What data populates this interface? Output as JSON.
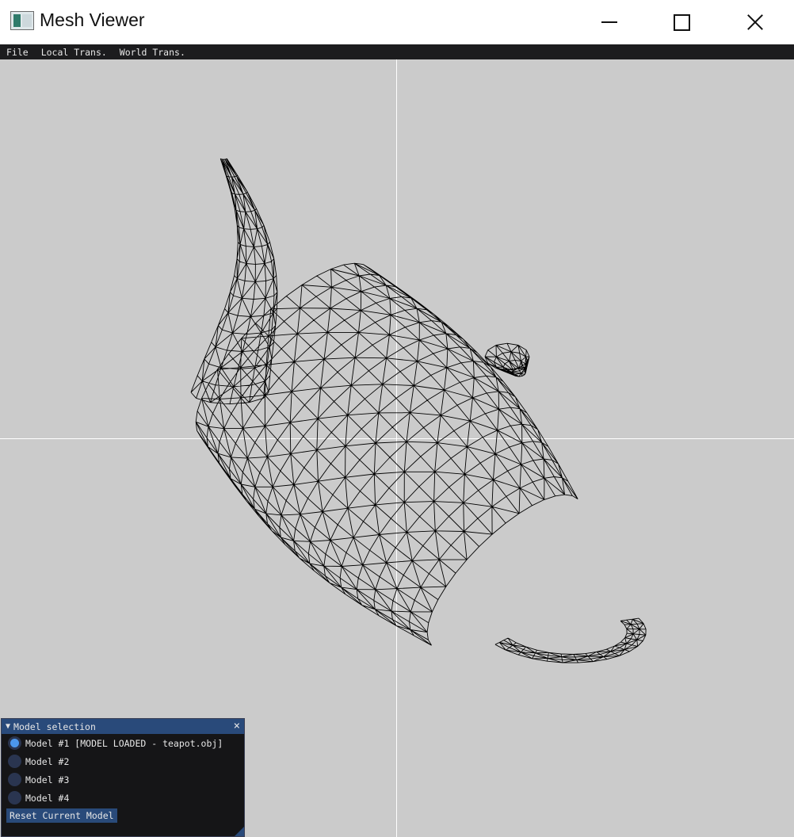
{
  "window": {
    "title": "Mesh Viewer",
    "icon": "app-window-icon",
    "controls": [
      "minimize-icon",
      "maximize-icon",
      "close-icon"
    ]
  },
  "menubar": {
    "items": [
      {
        "label": "File"
      },
      {
        "label": "Local Trans."
      },
      {
        "label": "World Trans."
      }
    ]
  },
  "viewport": {
    "background": "#cbcbcb",
    "axis_color": "#ffffff",
    "mesh_color": "#000000",
    "render_mode": "wireframe"
  },
  "model_panel": {
    "title": "Model selection",
    "collapse_icon": "▼",
    "close_icon": "×",
    "options": [
      {
        "label": "Model #1 [MODEL LOADED - teapot.obj]",
        "selected": true
      },
      {
        "label": "Model #2",
        "selected": false
      },
      {
        "label": "Model #3",
        "selected": false
      },
      {
        "label": "Model #4",
        "selected": false
      }
    ],
    "reset_label": "Reset Current Model",
    "accent": "#294a7a",
    "selected_color": "#4c97ec"
  }
}
